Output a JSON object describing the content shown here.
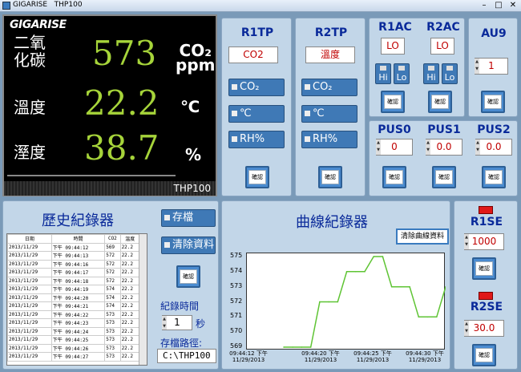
{
  "titlebar": {
    "app": "GIGARISE",
    "title": "THP100",
    "min": "–",
    "max": "□",
    "close": "✕"
  },
  "display": {
    "logo": "GIGARISE",
    "co2_label": "二氧\n化碳",
    "co2_value": "573",
    "co2_unit": "CO₂\nppm",
    "temp_label": "溫度",
    "temp_value": "22.2",
    "temp_unit": "℃",
    "hum_label": "溼度",
    "hum_value": "38.7",
    "hum_unit": "%",
    "model": "THP100"
  },
  "r1tp": {
    "title": "R1TP",
    "value": "CO2",
    "opt_co2": "CO₂",
    "opt_c": "℃",
    "opt_rh": "RH%",
    "confirm": "確認"
  },
  "r2tp": {
    "title": "R2TP",
    "value": "溫度",
    "opt_co2": "CO₂",
    "opt_c": "℃",
    "opt_rh": "RH%",
    "confirm": "確認"
  },
  "r1ac": {
    "title": "R1AC",
    "value": "LO",
    "hi": "Hi",
    "lo": "Lo",
    "confirm": "確認"
  },
  "r2ac": {
    "title": "R2AC",
    "value": "LO",
    "hi": "Hi",
    "lo": "Lo",
    "confirm": "確認"
  },
  "au9": {
    "title": "AU9",
    "value": "1",
    "confirm": "確認"
  },
  "pus0": {
    "title": "PUS0",
    "value": "0",
    "confirm": "確認"
  },
  "pus1": {
    "title": "PUS1",
    "value": "0.0",
    "confirm": "確認"
  },
  "pus2": {
    "title": "PUS2",
    "value": "0.0",
    "confirm": "確認"
  },
  "history": {
    "title": "歷史紀錄器",
    "save": "存檔",
    "clear": "清除資料",
    "confirm": "確認",
    "interval_label": "紀錄時間",
    "interval_value": "1",
    "interval_unit": "秒",
    "path_label": "存檔路徑:",
    "path_value": "C:\\THP100",
    "headers": [
      "日期",
      "時間",
      "CO2",
      "溫度"
    ],
    "rows": [
      [
        "2013/11/29",
        "下午 09:44:12",
        "569",
        "22.2"
      ],
      [
        "2013/11/29",
        "下午 09:44:13",
        "572",
        "22.2"
      ],
      [
        "2013/11/29",
        "下午 09:44:16",
        "572",
        "22.2"
      ],
      [
        "2013/11/29",
        "下午 09:44:17",
        "572",
        "22.2"
      ],
      [
        "2013/11/29",
        "下午 09:44:18",
        "572",
        "22.2"
      ],
      [
        "2013/11/29",
        "下午 09:44:19",
        "574",
        "22.2"
      ],
      [
        "2013/11/29",
        "下午 09:44:20",
        "574",
        "22.2"
      ],
      [
        "2013/11/29",
        "下午 09:44:21",
        "574",
        "22.2"
      ],
      [
        "2013/11/29",
        "下午 09:44:22",
        "573",
        "22.2"
      ],
      [
        "2013/11/29",
        "下午 09:44:23",
        "573",
        "22.2"
      ],
      [
        "2013/11/29",
        "下午 09:44:24",
        "573",
        "22.2"
      ],
      [
        "2013/11/29",
        "下午 09:44:25",
        "573",
        "22.2"
      ],
      [
        "2013/11/29",
        "下午 09:44:26",
        "573",
        "22.2"
      ],
      [
        "2013/11/29",
        "下午 09:44:27",
        "573",
        "22.2"
      ]
    ]
  },
  "curve": {
    "title": "曲線紀錄器",
    "clear": "清除曲線資料"
  },
  "r1se": {
    "title": "R1SE",
    "value": "1000",
    "confirm": "確認"
  },
  "r2se": {
    "title": "R2SE",
    "value": "30.0",
    "confirm": "確認"
  },
  "chart_data": {
    "type": "line",
    "title": "",
    "xlabel": "",
    "ylabel": "",
    "ylim": [
      569,
      575
    ],
    "yticks": [
      "575",
      "574",
      "573",
      "572",
      "571",
      "570",
      "569"
    ],
    "xticks": [
      "09:44:12 下午\n11/29/2013",
      "09:44:20 下午\n11/29/2013",
      "09:44:25 下午\n11/29/2013",
      "09:44:30 下午\n11/29/2013"
    ],
    "series": [
      {
        "values": [
          569,
          569,
          569,
          569,
          572,
          572,
          572,
          574,
          574,
          574,
          575,
          575,
          573,
          573,
          573,
          571,
          571,
          571,
          573
        ]
      }
    ],
    "color": "#5fc434"
  }
}
